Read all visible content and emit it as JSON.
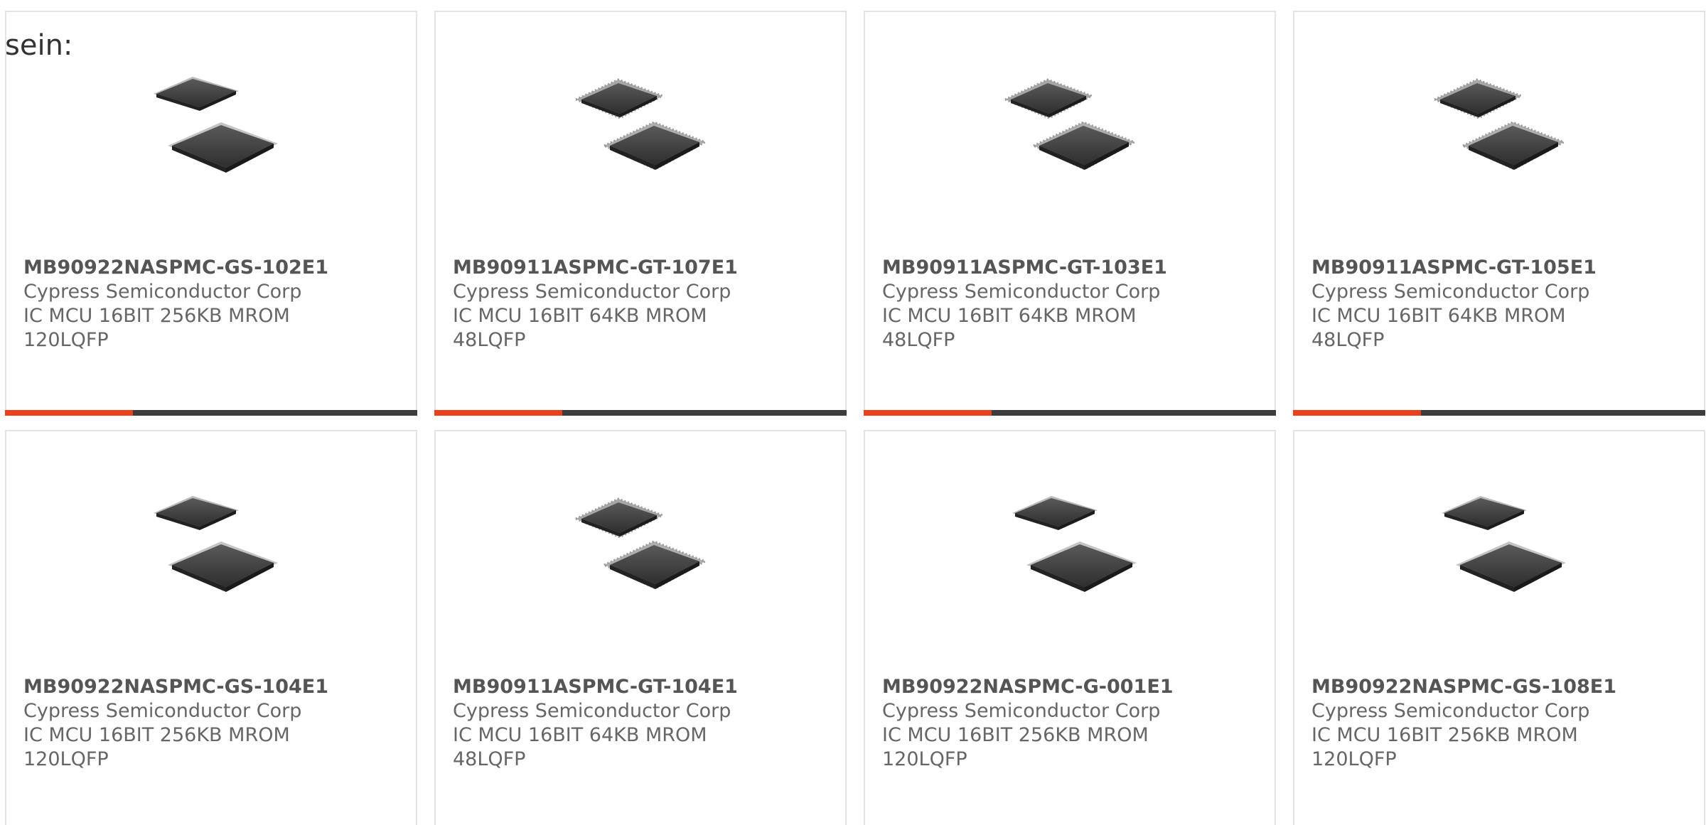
{
  "lead_text": "sein:",
  "colors": {
    "accent": "#e8411c",
    "bar_track": "#3c3c3c",
    "card_border": "#e3e3e3",
    "text": "#666666"
  },
  "products": [
    {
      "part_number": "MB90922NASPMC-GS-102E1",
      "manufacturer": "Cypress Semiconductor Corp",
      "desc_line1": "IC MCU 16BIT 256KB MROM",
      "desc_line2": "120LQFP",
      "image_icon": "qfp-chip-pair-icon",
      "progress": 0.31
    },
    {
      "part_number": "MB90911ASPMC-GT-107E1",
      "manufacturer": "Cypress Semiconductor Corp",
      "desc_line1": "IC MCU 16BIT 64KB MROM",
      "desc_line2": "48LQFP",
      "image_icon": "qfp-chip-pair-icon",
      "progress": 0.31
    },
    {
      "part_number": "MB90911ASPMC-GT-103E1",
      "manufacturer": "Cypress Semiconductor Corp",
      "desc_line1": "IC MCU 16BIT 64KB MROM",
      "desc_line2": "48LQFP",
      "image_icon": "qfp-chip-pair-icon",
      "progress": 0.31
    },
    {
      "part_number": "MB90911ASPMC-GT-105E1",
      "manufacturer": "Cypress Semiconductor Corp",
      "desc_line1": "IC MCU 16BIT 64KB MROM",
      "desc_line2": "48LQFP",
      "image_icon": "qfp-chip-pair-icon",
      "progress": 0.31
    },
    {
      "part_number": "MB90922NASPMC-GS-104E1",
      "manufacturer": "Cypress Semiconductor Corp",
      "desc_line1": "IC MCU 16BIT 256KB MROM",
      "desc_line2": "120LQFP",
      "image_icon": "qfp-chip-pair-icon"
    },
    {
      "part_number": "MB90911ASPMC-GT-104E1",
      "manufacturer": "Cypress Semiconductor Corp",
      "desc_line1": "IC MCU 16BIT 64KB MROM",
      "desc_line2": "48LQFP",
      "image_icon": "qfp-chip-pair-icon"
    },
    {
      "part_number": "MB90922NASPMC-G-001E1",
      "manufacturer": "Cypress Semiconductor Corp",
      "desc_line1": "IC MCU 16BIT 256KB MROM",
      "desc_line2": "120LQFP",
      "image_icon": "qfp-chip-pair-icon"
    },
    {
      "part_number": "MB90922NASPMC-GS-108E1",
      "manufacturer": "Cypress Semiconductor Corp",
      "desc_line1": "IC MCU 16BIT 256KB MROM",
      "desc_line2": "120LQFP",
      "image_icon": "qfp-chip-pair-icon"
    }
  ]
}
